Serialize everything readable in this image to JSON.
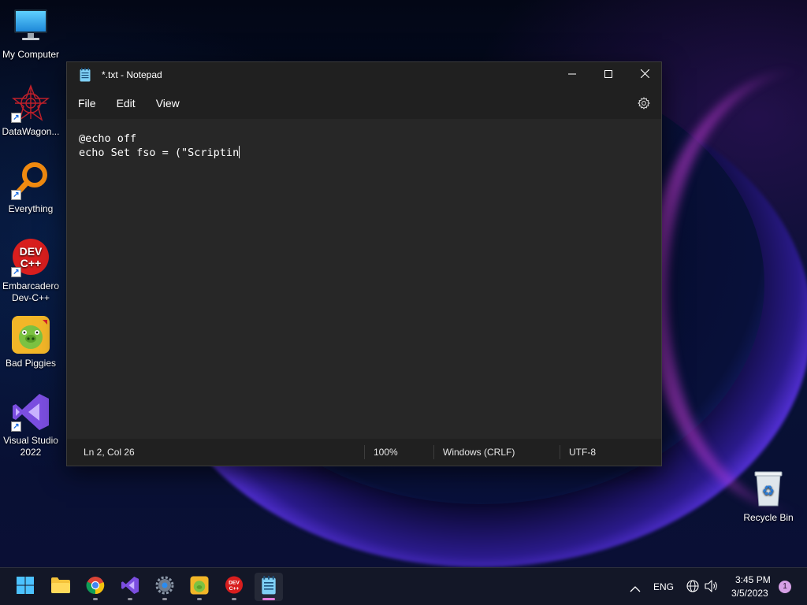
{
  "desktop": {
    "icons": [
      {
        "label": "My Computer",
        "icon": "monitor-icon"
      },
      {
        "label": "DataWagon...",
        "icon": "datawagon-icon"
      },
      {
        "label": "Everything",
        "icon": "magnifier-icon"
      },
      {
        "label": "Embarcadero Dev-C++",
        "icon": "devcpp-icon"
      },
      {
        "label": "Bad Piggies",
        "icon": "pig-icon"
      },
      {
        "label": "Visual Studio 2022",
        "icon": "visual-studio-icon"
      },
      {
        "label": "Recycle Bin",
        "icon": "recycle-bin-icon"
      }
    ]
  },
  "notepad": {
    "title": "*.txt - Notepad",
    "menu": [
      "File",
      "Edit",
      "View"
    ],
    "lines": [
      "@echo off",
      "echo Set fso = (\"Scriptin"
    ],
    "status": {
      "position": "Ln 2, Col 26",
      "zoom": "100%",
      "line_ending": "Windows (CRLF)",
      "encoding": "UTF-8"
    }
  },
  "taskbar": {
    "apps": [
      "start-icon",
      "file-explorer-icon",
      "chrome-icon",
      "visual-studio-icon",
      "settings-icon",
      "bad-piggies-icon",
      "devcpp-icon",
      "notepad-icon"
    ],
    "language": "ENG",
    "time": "3:45 PM",
    "date": "3/5/2023",
    "notification_count": "1"
  },
  "colors": {
    "window_bg": "#202020",
    "editor_bg": "#272727",
    "accent": "#e07ad8"
  }
}
